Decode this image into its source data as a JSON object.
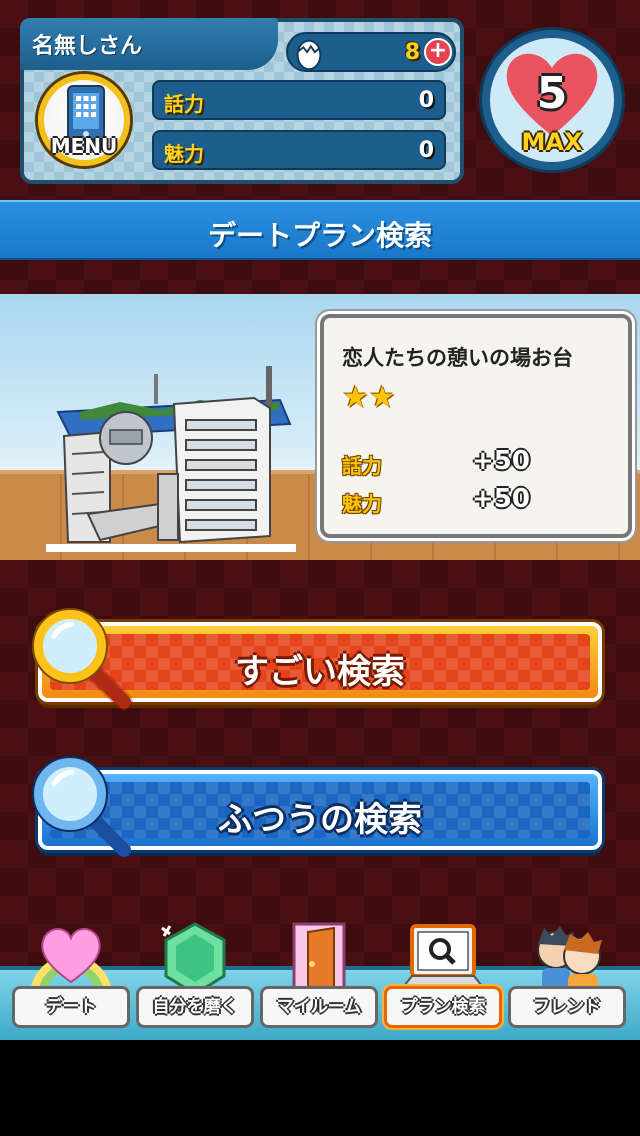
{
  "player": {
    "name": "名無しさん",
    "eggs": "8",
    "add_symbol": "+",
    "menu_label": "MENU",
    "stats": [
      {
        "label": "話力",
        "value": "0"
      },
      {
        "label": "魅力",
        "value": "0"
      }
    ]
  },
  "hearts": {
    "count": "5",
    "status": "MAX"
  },
  "page": {
    "title": "デートプラン検索"
  },
  "location": {
    "name": "恋人たちの憩いの場お台",
    "stars": 2,
    "bonuses": [
      {
        "label": "話力",
        "value": "+50"
      },
      {
        "label": "魅力",
        "value": "+50"
      }
    ]
  },
  "actions": {
    "super_search": "すごい検索",
    "normal_search": "ふつうの検索"
  },
  "nav": [
    {
      "label": "デート",
      "icon": "heart-rainbow-icon"
    },
    {
      "label": "自分を磨く",
      "icon": "gem-icon"
    },
    {
      "label": "マイルーム",
      "icon": "door-icon"
    },
    {
      "label": "プラン検索",
      "icon": "laptop-search-icon",
      "active": true
    },
    {
      "label": "フレンド",
      "icon": "friends-icon"
    }
  ],
  "colors": {
    "accent_blue": "#1a78c8",
    "gold": "#ffd21e",
    "heart_red": "#e85560",
    "super_orange": "#f28a12"
  }
}
